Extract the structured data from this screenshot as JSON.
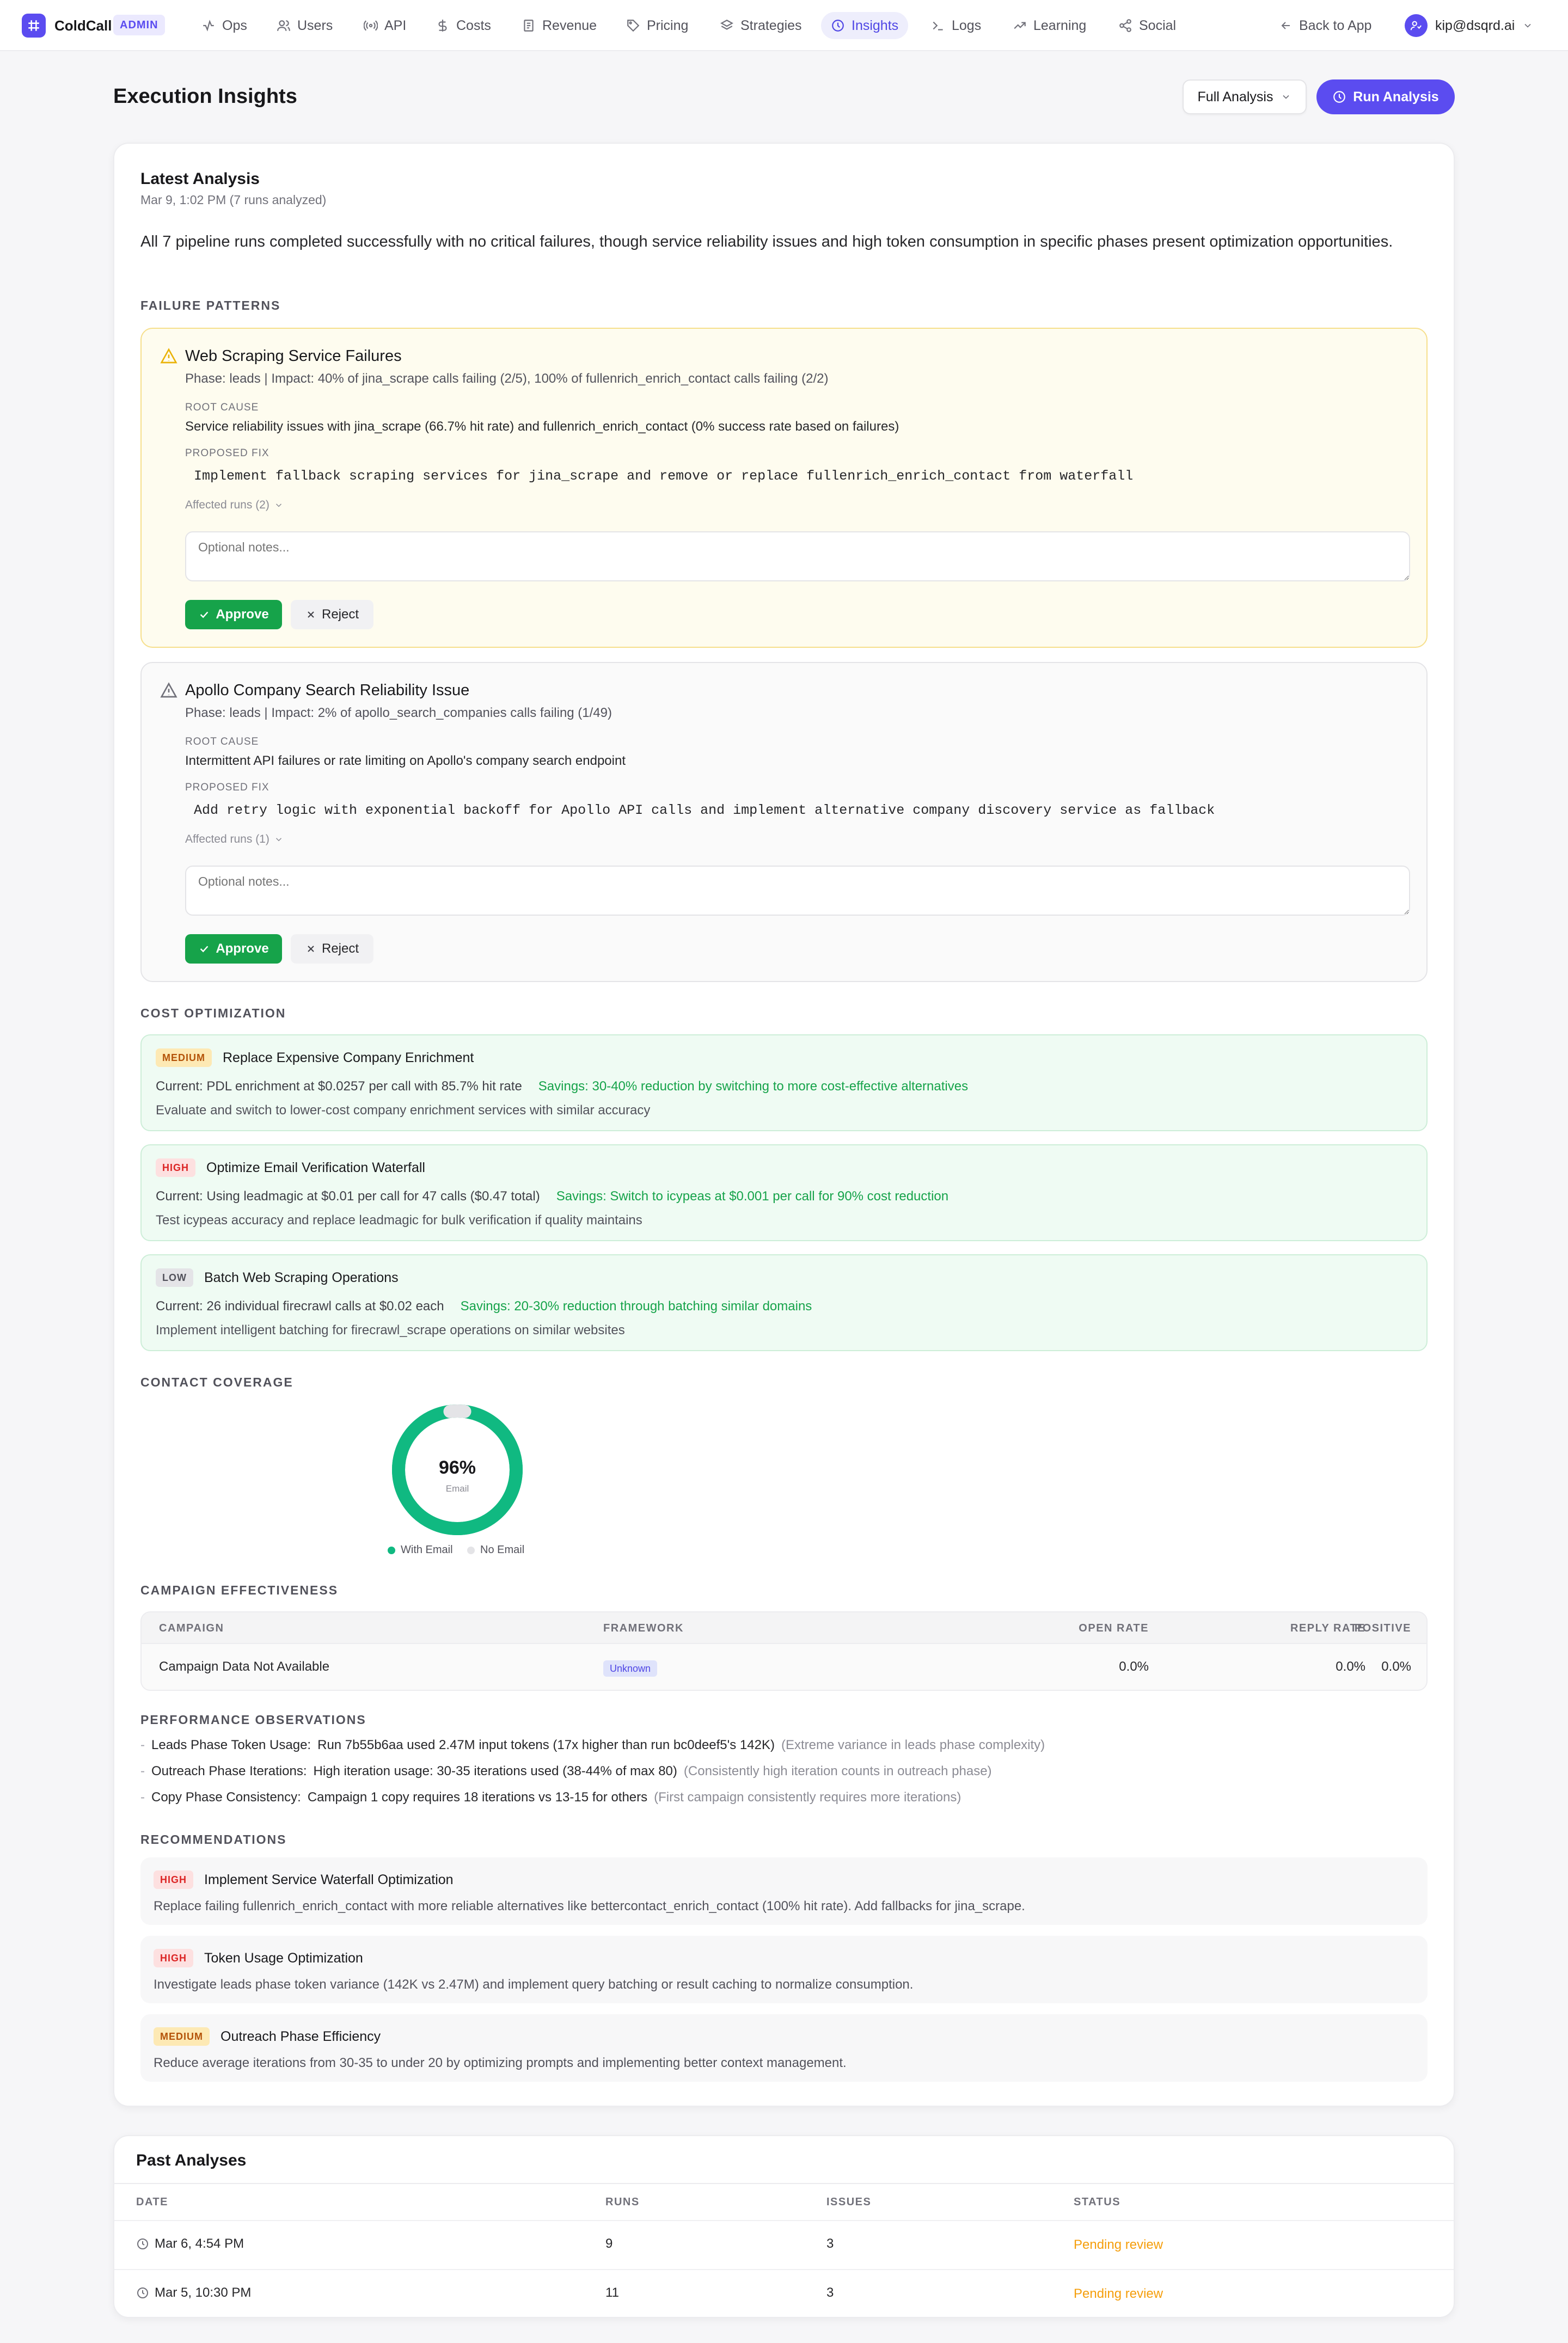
{
  "nav": {
    "brand": "ColdCall",
    "badge": "ADMIN",
    "items": [
      {
        "label": "Ops",
        "icon": "activity-icon"
      },
      {
        "label": "Users",
        "icon": "users-icon"
      },
      {
        "label": "API",
        "icon": "broadcast-icon"
      },
      {
        "label": "Costs",
        "icon": "dollar-icon"
      },
      {
        "label": "Revenue",
        "icon": "receipt-icon"
      },
      {
        "label": "Pricing",
        "icon": "tag-icon"
      },
      {
        "label": "Strategies",
        "icon": "layers-icon"
      },
      {
        "label": "Insights",
        "icon": "insights-icon",
        "active": true
      },
      {
        "label": "Logs",
        "icon": "terminal-icon"
      },
      {
        "label": "Learning",
        "icon": "trending-icon"
      },
      {
        "label": "Social",
        "icon": "share-icon"
      }
    ],
    "back": "Back to App",
    "user": "kip@dsqrd.ai"
  },
  "header": {
    "title": "Execution Insights",
    "mode_select": "Full Analysis",
    "run_button": "Run Analysis"
  },
  "latest": {
    "title": "Latest Analysis",
    "date": "Mar 9, 1:02 PM (7 runs analyzed)",
    "summary": "All 7 pipeline runs completed successfully with no critical failures, though service reliability issues and high token consumption in specific phases present optimization opportunities."
  },
  "labels": {
    "failure_patterns": "FAILURE PATTERNS",
    "root_cause": "ROOT CAUSE",
    "proposed_fix": "PROPOSED FIX",
    "notes_placeholder": "Optional notes...",
    "approve": "Approve",
    "reject": "Reject",
    "cost_optimization": "COST OPTIMIZATION",
    "contact_coverage": "CONTACT COVERAGE",
    "campaign_effectiveness": "CAMPAIGN EFFECTIVENESS",
    "performance_observations": "PERFORMANCE OBSERVATIONS",
    "recommendations": "RECOMMENDATIONS"
  },
  "failures": [
    {
      "title": "Web Scraping Service Failures",
      "phase": "Phase: leads | Impact: 40% of jina_scrape calls failing (2/5), 100% of fullenrich_enrich_contact calls failing (2/2)",
      "root_cause": "Service reliability issues with jina_scrape (66.7% hit rate) and fullenrich_enrich_contact (0% success rate based on failures)",
      "fix": "Implement fallback scraping services for jina_scrape and remove or replace fullenrich_enrich_contact from waterfall",
      "affected": "Affected runs (2)"
    },
    {
      "title": "Apollo Company Search Reliability Issue",
      "phase": "Phase: leads | Impact: 2% of apollo_search_companies calls failing (1/49)",
      "root_cause": "Intermittent API failures or rate limiting on Apollo's company search endpoint",
      "fix": "Add retry logic with exponential backoff for Apollo API calls and implement alternative company discovery service as fallback",
      "affected": "Affected runs (1)"
    }
  ],
  "costs": [
    {
      "priority": "MEDIUM",
      "title": "Replace Expensive Company Enrichment",
      "current": "Current: PDL enrichment at $0.0257 per call with 85.7% hit rate",
      "savings": "Savings: 30-40% reduction by switching to more cost-effective alternatives",
      "desc": "Evaluate and switch to lower-cost company enrichment services with similar accuracy"
    },
    {
      "priority": "HIGH",
      "title": "Optimize Email Verification Waterfall",
      "current": "Current: Using leadmagic at $0.01 per call for 47 calls ($0.47 total)",
      "savings": "Savings: Switch to icypeas at $0.001 per call for 90% cost reduction",
      "desc": "Test icypeas accuracy and replace leadmagic for bulk verification if quality maintains"
    },
    {
      "priority": "LOW",
      "title": "Batch Web Scraping Operations",
      "current": "Current: 26 individual firecrawl calls at $0.02 each",
      "savings": "Savings: 20-30% reduction through batching similar domains",
      "desc": "Implement intelligent batching for firecrawl_scrape operations on similar websites"
    }
  ],
  "coverage": {
    "percent_label": "96%",
    "center_sub": "Email",
    "legend_with": "With Email",
    "legend_without": "No Email",
    "color_with": "#10b981",
    "color_without": "#e4e4e7"
  },
  "chart_data": {
    "type": "pie",
    "categories": [
      "With Email",
      "No Email"
    ],
    "values": [
      96,
      4
    ],
    "title": ""
  },
  "campaign": {
    "columns": [
      "CAMPAIGN",
      "FRAMEWORK",
      "OPEN RATE",
      "REPLY RATE",
      "POSITIVE"
    ],
    "row": {
      "name": "Campaign Data Not Available",
      "framework": "Unknown",
      "open": "0.0%",
      "reply": "0.0%",
      "positive": "0.0%"
    }
  },
  "performance": [
    {
      "title": "Leads Phase Token Usage:",
      "text": "Run 7b55b6aa used 2.47M input tokens (17x higher than run bc0deef5's 142K)",
      "note": "(Extreme variance in leads phase complexity)"
    },
    {
      "title": "Outreach Phase Iterations:",
      "text": "High iteration usage: 30-35 iterations used (38-44% of max 80)",
      "note": "(Consistently high iteration counts in outreach phase)"
    },
    {
      "title": "Copy Phase Consistency:",
      "text": "Campaign 1 copy requires 18 iterations vs 13-15 for others",
      "note": "(First campaign consistently requires more iterations)"
    }
  ],
  "recommendations": [
    {
      "priority": "HIGH",
      "title": "Implement Service Waterfall Optimization",
      "desc": "Replace failing fullenrich_enrich_contact with more reliable alternatives like bettercontact_enrich_contact (100% hit rate). Add fallbacks for jina_scrape."
    },
    {
      "priority": "HIGH",
      "title": "Token Usage Optimization",
      "desc": "Investigate leads phase token variance (142K vs 2.47M) and implement query batching or result caching to normalize consumption."
    },
    {
      "priority": "MEDIUM",
      "title": "Outreach Phase Efficiency",
      "desc": "Reduce average iterations from 30-35 to under 20 by optimizing prompts and implementing better context management."
    }
  ],
  "past": {
    "title": "Past Analyses",
    "columns": [
      "DATE",
      "RUNS",
      "ISSUES",
      "STATUS"
    ],
    "rows": [
      {
        "date": "Mar 6, 4:54 PM",
        "runs": "9",
        "issues": "3",
        "status": "Pending review"
      },
      {
        "date": "Mar 5, 10:30 PM",
        "runs": "11",
        "issues": "3",
        "status": "Pending review"
      }
    ]
  }
}
